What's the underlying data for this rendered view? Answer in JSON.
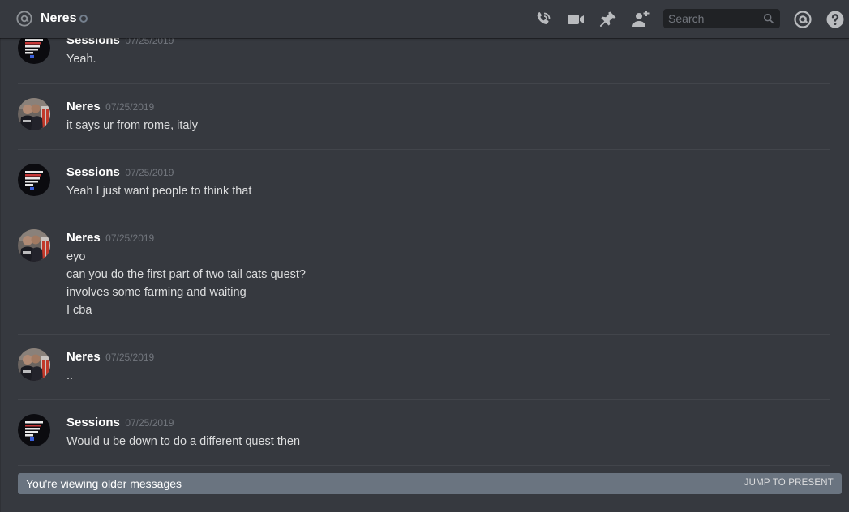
{
  "header": {
    "channel_name": "Neres",
    "search_placeholder": "Search",
    "icons": [
      "at-icon",
      "call-icon",
      "video-icon",
      "pin-icon",
      "add-member-icon",
      "search-icon",
      "mention-icon",
      "help-icon"
    ]
  },
  "messages": [
    {
      "author": "Sessions",
      "timestamp": "07/25/2019",
      "lines": [
        "Yeah."
      ]
    },
    {
      "author": "Neres",
      "timestamp": "07/25/2019",
      "lines": [
        "it says ur from rome, italy"
      ]
    },
    {
      "author": "Sessions",
      "timestamp": "07/25/2019",
      "lines": [
        "Yeah I just want people to think that"
      ]
    },
    {
      "author": "Neres",
      "timestamp": "07/25/2019",
      "lines": [
        "eyo",
        "can you do the first part of two tail cats quest?",
        "involves some farming and waiting",
        "I cba"
      ]
    },
    {
      "author": "Neres",
      "timestamp": "07/25/2019",
      "lines": [
        ".."
      ]
    },
    {
      "author": "Sessions",
      "timestamp": "07/25/2019",
      "lines": [
        "Would u be down to do a different quest then"
      ]
    }
  ],
  "older_bar": {
    "text": "You're viewing older messages",
    "action": "JUMP TO PRESENT"
  },
  "colors": {
    "background": "#36393f",
    "header_text": "#ffffff",
    "message_text": "#dcddde",
    "timestamp": "#72767d",
    "older_bar": "#6a7480"
  }
}
